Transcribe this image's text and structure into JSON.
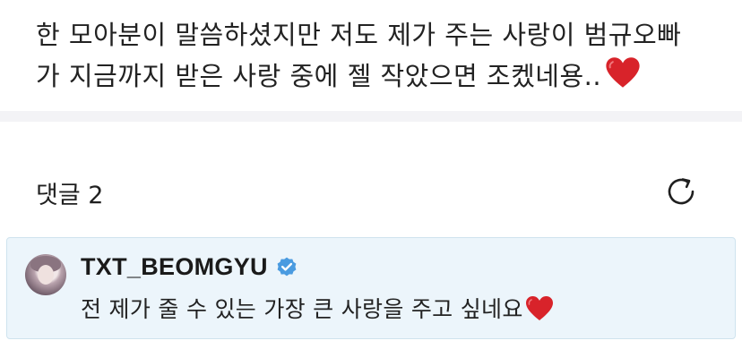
{
  "post": {
    "line1": "한 모아분이 말씀하셨지만 저도 제가 주는 사랑이 범규오빠",
    "line2": "가 지금까지 받은 사랑 중에 젤 작았으면 조켔네용..",
    "end_icon": "red-heart-icon"
  },
  "comments": {
    "label": "댓글 2",
    "refresh_icon": "refresh-icon",
    "items": [
      {
        "author": "TXT_BEOMGYU",
        "verified": true,
        "text": "전 제가 줄 수 있는 가장 큰 사랑을 주고 싶네요",
        "end_icon": "red-heart-icon"
      }
    ]
  },
  "colors": {
    "heart": "#d8232a",
    "verified": "#4a9be0",
    "card_bg": "#ecf5fb",
    "card_border": "#cfe3ee",
    "divider": "#f3f3f6"
  }
}
